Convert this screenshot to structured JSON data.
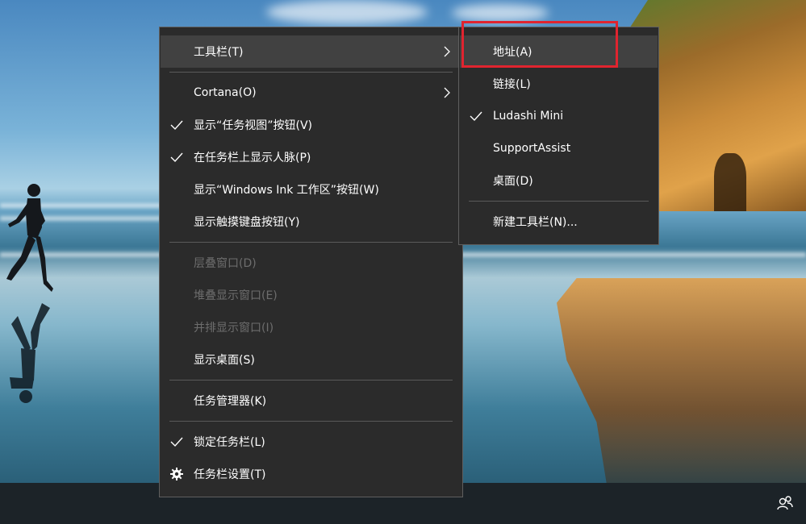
{
  "main_menu": {
    "items": [
      {
        "label": "工具栏(T)",
        "checked": false,
        "disabled": false,
        "has_submenu": true,
        "highlighted": true
      },
      {
        "label": "Cortana(O)",
        "checked": false,
        "disabled": false,
        "has_submenu": true
      },
      {
        "label": "显示“任务视图”按钮(V)",
        "checked": true,
        "disabled": false
      },
      {
        "label": "在任务栏上显示人脉(P)",
        "checked": true,
        "disabled": false
      },
      {
        "label": "显示“Windows Ink 工作区”按钮(W)",
        "checked": false,
        "disabled": false
      },
      {
        "label": "显示触摸键盘按钮(Y)",
        "checked": false,
        "disabled": false
      },
      {
        "label": "层叠窗口(D)",
        "checked": false,
        "disabled": true
      },
      {
        "label": "堆叠显示窗口(E)",
        "checked": false,
        "disabled": true
      },
      {
        "label": "并排显示窗口(I)",
        "checked": false,
        "disabled": true
      },
      {
        "label": "显示桌面(S)",
        "checked": false,
        "disabled": false
      },
      {
        "label": "任务管理器(K)",
        "checked": false,
        "disabled": false
      },
      {
        "label": "锁定任务栏(L)",
        "checked": true,
        "disabled": false
      },
      {
        "label": "任务栏设置(T)",
        "checked": false,
        "disabled": false,
        "icon": "gear-icon"
      }
    ]
  },
  "toolbar_submenu": {
    "items": [
      {
        "label": "地址(A)",
        "checked": false,
        "highlighted": true
      },
      {
        "label": "链接(L)",
        "checked": false
      },
      {
        "label": "Ludashi Mini",
        "checked": true
      },
      {
        "label": "SupportAssist",
        "checked": false
      },
      {
        "label": "桌面(D)",
        "checked": false
      },
      {
        "label": "新建工具栏(N)...",
        "checked": false
      }
    ]
  },
  "colors": {
    "menu_bg": "#2b2b2b",
    "menu_hover": "#414141",
    "menu_border": "#5f5f5f",
    "disabled_text": "#6d6d6d",
    "highlight_box": "#e0242f",
    "taskbar": "#1c2328"
  },
  "icons": {
    "submenu_arrow": "chevron-right-icon",
    "check": "checkmark-icon",
    "settings": "gear-icon",
    "taskbar_people": "people-icon"
  }
}
